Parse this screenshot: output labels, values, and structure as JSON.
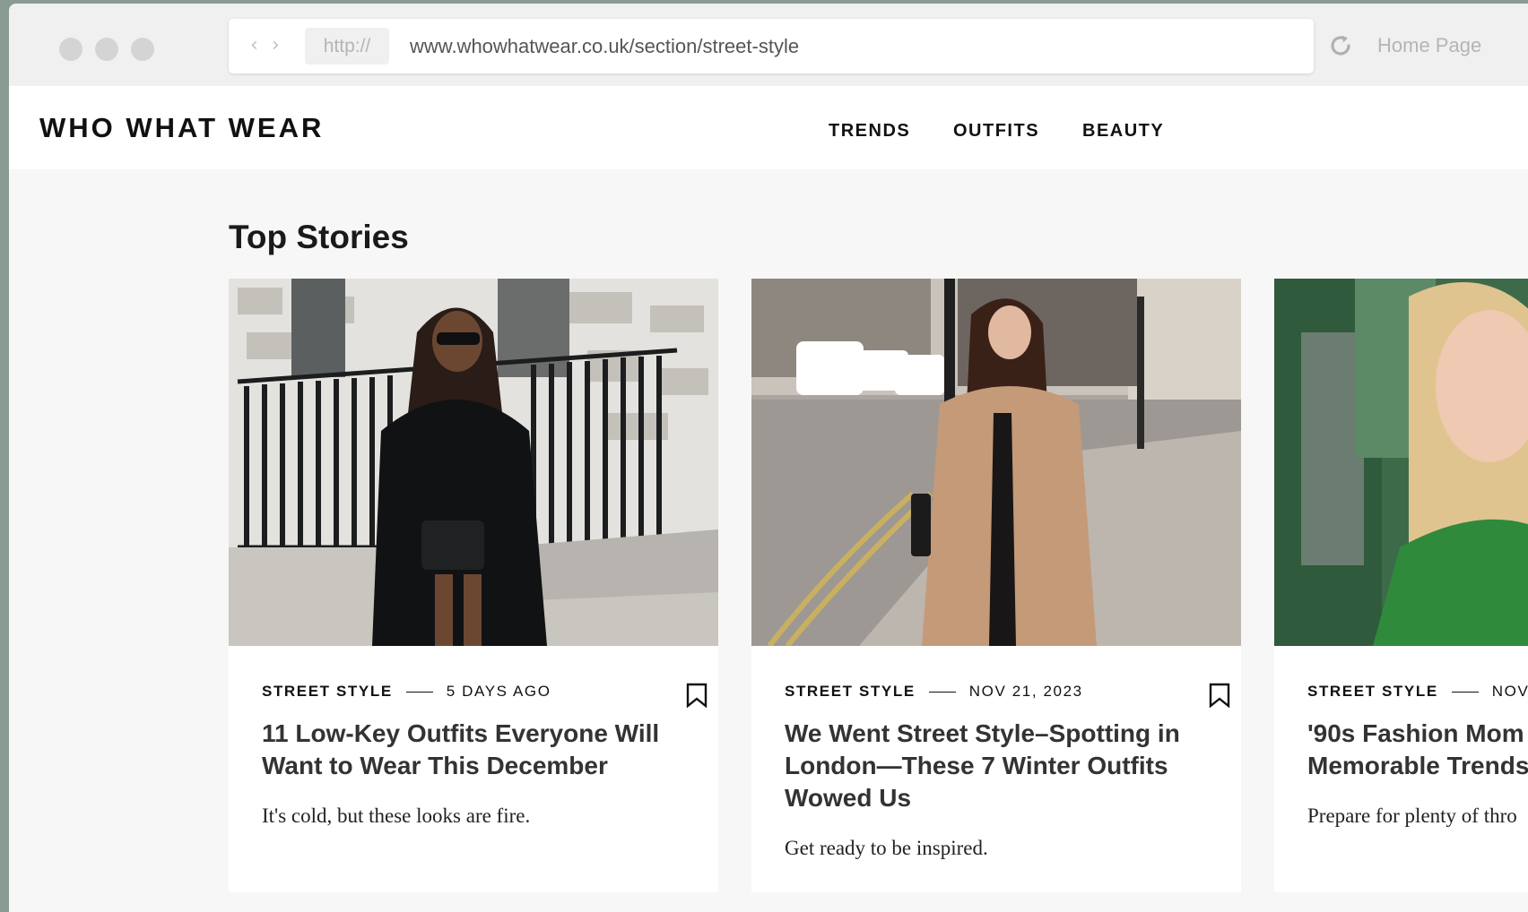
{
  "browser": {
    "protocol": "http://",
    "url": "www.whowhatwear.co.uk/section/street-style",
    "home_label": "Home Page",
    "back_glyph": "‹",
    "forward_glyph": "›"
  },
  "site": {
    "logo": "WHO WHAT WEAR",
    "nav": [
      {
        "label": "TRENDS"
      },
      {
        "label": "OUTFITS"
      },
      {
        "label": "BEAUTY"
      }
    ]
  },
  "main": {
    "section_title": "Top Stories",
    "cards": [
      {
        "category": "STREET STYLE",
        "date": "5 DAYS AGO",
        "headline": "11 Low-Key Outfits Everyone Will\nWant to Wear This December",
        "dek": "It's cold, but these looks are fire."
      },
      {
        "category": "STREET STYLE",
        "date": "NOV 21, 2023",
        "headline": "We Went Street Style–Spotting in\nLondon—These 7 Winter Outfits\nWowed Us",
        "dek": "Get ready to be inspired."
      },
      {
        "category": "STREET STYLE",
        "date": "NOV",
        "headline": "'90s Fashion Mom\nMemorable Trends",
        "dek": "Prepare for plenty of thro"
      }
    ]
  },
  "icons": {
    "reload": "reload-icon",
    "bookmark": "bookmark-icon"
  },
  "colors": {
    "page_background": "#f7f7f7",
    "chrome_background": "#f0f0f0",
    "text_dark": "#111111",
    "headline": "#333333"
  }
}
